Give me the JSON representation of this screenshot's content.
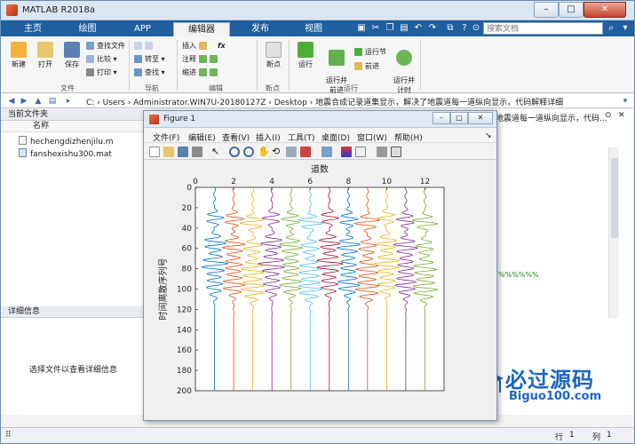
{
  "window": {
    "title": "MATLAB R2018a",
    "controls": [
      "–",
      "□",
      "✕"
    ]
  },
  "tabs": [
    {
      "label": "主页",
      "active": false
    },
    {
      "label": "绘图",
      "active": false
    },
    {
      "label": "APP",
      "active": false
    },
    {
      "label": "编辑器",
      "active": true
    },
    {
      "label": "发布",
      "active": false
    },
    {
      "label": "视图",
      "active": false
    }
  ],
  "search": {
    "placeholder": "搜索文档"
  },
  "ribbon": {
    "new": "新建",
    "open": "打开",
    "save": "保存",
    "find_files": "查找文件",
    "compare": "比较",
    "print": "打印",
    "file_group": "文件",
    "goto": "转至",
    "find": "查找",
    "nav_group": "导航",
    "insert": "插入",
    "comment": "注释",
    "indent": "缩进",
    "fx": "fx",
    "edit_group": "编辑",
    "breakpoints": "断点",
    "bp_group": "断点",
    "run": "运行",
    "run_advance": "运行并\n前进",
    "run_section": "运行节",
    "advance": "前进",
    "run_time": "运行并\n计时",
    "run_group": "运行"
  },
  "address_bar": {
    "path": "C: › Users › Administrator.WIN7U-20180127Z › Desktop › 地震合成记录道集显示，解决了地震道每一道纵向显示，代码解释详细"
  },
  "current_folder": {
    "header": "当前文件夹",
    "column": "名称",
    "files": [
      {
        "name": "hechengdizhenjilu.m",
        "type": "m"
      },
      {
        "name": "fanshexishu300.mat",
        "type": "mat"
      }
    ]
  },
  "details": {
    "header": "详细信息",
    "empty_text": "选择文件以查看详细信息"
  },
  "editor_right": {
    "text": "地震道每一道纵向显示，代码...",
    "fragment": "%%%%%%"
  },
  "statusbar": {
    "row_label": "行",
    "row": "1",
    "col_label": "列",
    "col": "1"
  },
  "watermark": {
    "brand": "必过源码",
    "url": "Biguo100.com"
  },
  "figure": {
    "title": "Figure 1",
    "menu": [
      "文件(F)",
      "编辑(E)",
      "查看(V)",
      "插入(I)",
      "工具(T)",
      "桌面(D)",
      "窗口(W)",
      "帮助(H)"
    ],
    "toolbar_icons": [
      "new-figure-icon",
      "open-icon",
      "save-icon",
      "print-icon",
      "pointer-icon",
      "zoom-in-icon",
      "zoom-out-icon",
      "pan-icon",
      "rotate-icon",
      "data-cursor-icon",
      "brush-icon",
      "link-icon",
      "colorbar-icon",
      "legend-icon",
      "hide-tools-icon",
      "show-tools-icon"
    ]
  },
  "chart_data": {
    "type": "line",
    "title": "道数",
    "xlabel": "",
    "ylabel": "时间离散序列号",
    "x_ticks": [
      0,
      2,
      4,
      6,
      8,
      10,
      12
    ],
    "y_ticks": [
      0,
      20,
      40,
      60,
      80,
      100,
      120,
      140,
      160,
      180,
      200
    ],
    "xlim": [
      0,
      13
    ],
    "ylim": [
      0,
      200
    ],
    "y_reversed": true,
    "x_axis_location": "top",
    "grid": false,
    "series": [
      {
        "trace": 1,
        "color": "#0072BD",
        "values_sparse": {
          "event_depths": [
            30,
            55,
            75,
            95
          ]
        }
      },
      {
        "trace": 2,
        "color": "#D95319",
        "values_sparse": {
          "event_depths": [
            30,
            55,
            75,
            95
          ]
        }
      },
      {
        "trace": 3,
        "color": "#EDB120",
        "values_sparse": {
          "event_depths": [
            30,
            55,
            75,
            95
          ]
        }
      },
      {
        "trace": 4,
        "color": "#7E2F8E",
        "values_sparse": {
          "event_depths": [
            30,
            55,
            75,
            95
          ]
        }
      },
      {
        "trace": 5,
        "color": "#77AC30",
        "values_sparse": {
          "event_depths": [
            30,
            55,
            75,
            95
          ]
        }
      },
      {
        "trace": 6,
        "color": "#4DBEEE",
        "values_sparse": {
          "event_depths": [
            30,
            55,
            75,
            95
          ]
        }
      },
      {
        "trace": 7,
        "color": "#A2142F",
        "values_sparse": {
          "event_depths": [
            30,
            55,
            75,
            95
          ]
        }
      },
      {
        "trace": 8,
        "color": "#0072BD",
        "values_sparse": {
          "event_depths": [
            30,
            55,
            75,
            95
          ]
        }
      },
      {
        "trace": 9,
        "color": "#D95319",
        "values_sparse": {
          "event_depths": [
            30,
            55,
            75,
            95
          ]
        }
      },
      {
        "trace": 10,
        "color": "#EDB120",
        "values_sparse": {
          "event_depths": [
            30,
            55,
            75,
            95
          ]
        }
      },
      {
        "trace": 11,
        "color": "#7E2F8E",
        "values_sparse": {
          "event_depths": [
            30,
            55,
            75,
            95
          ]
        }
      },
      {
        "trace": 12,
        "color": "#77AC30",
        "values_sparse": {
          "event_depths": [
            30,
            55,
            75,
            95
          ]
        }
      }
    ]
  }
}
